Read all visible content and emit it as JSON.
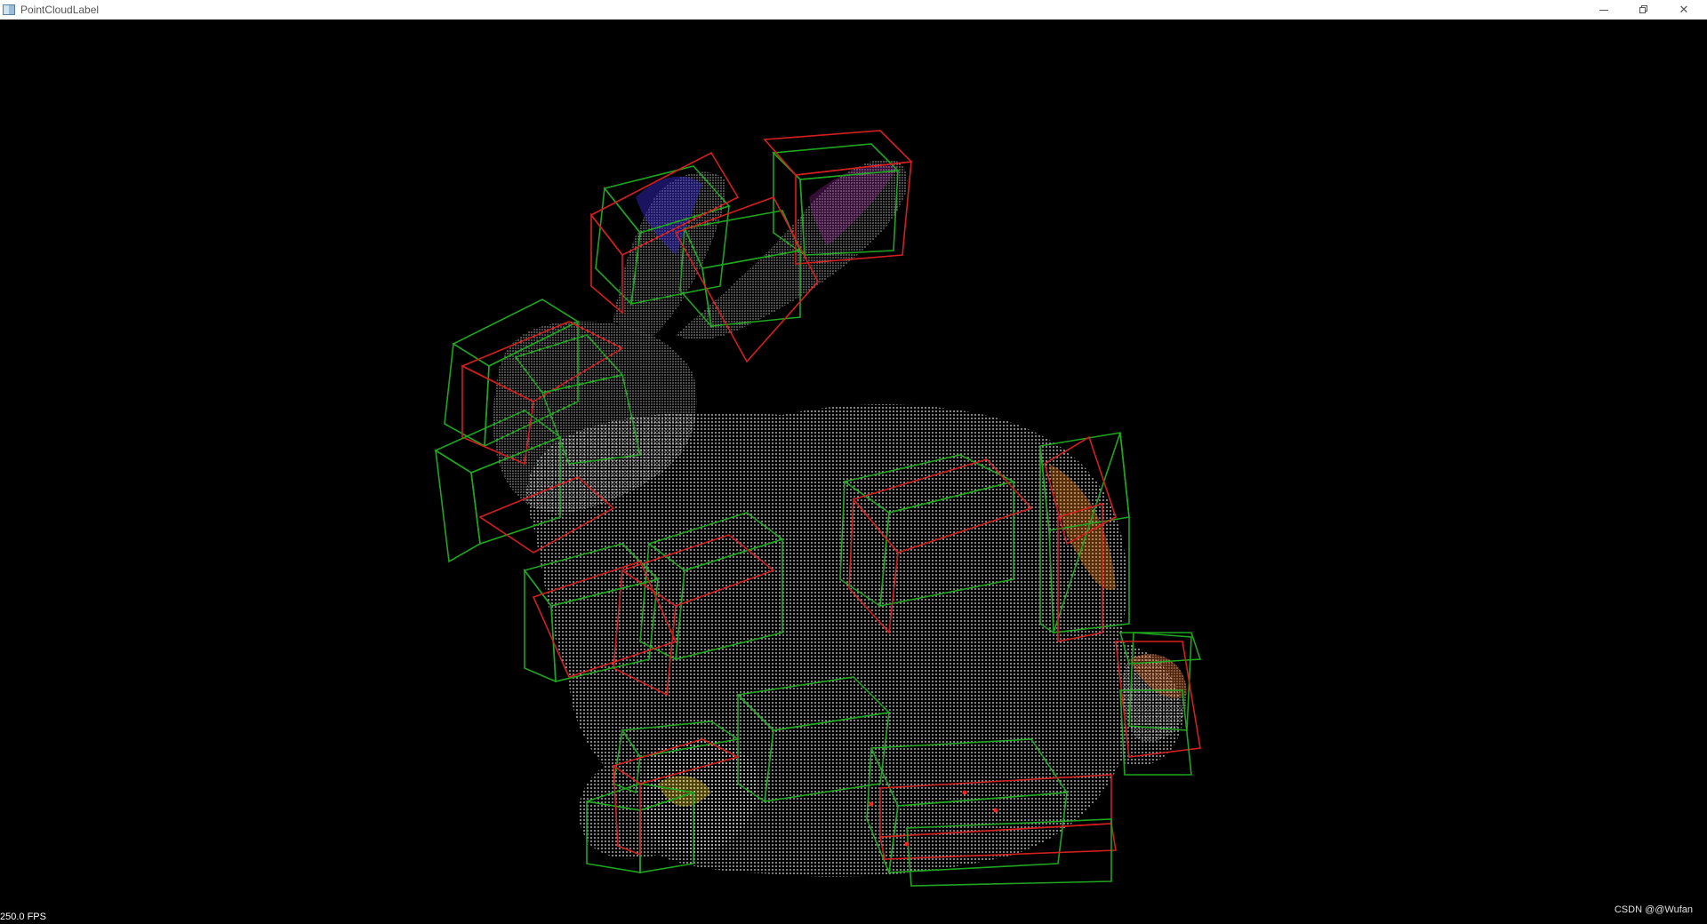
{
  "window": {
    "title": "PointCloudLabel",
    "controls": {
      "minimize": "minimize",
      "restore": "restore",
      "close": "close"
    }
  },
  "viewport": {
    "background": "#000000",
    "point_color": "#ffffff",
    "box_colors": [
      "#1fa51f",
      "#d41f1f"
    ],
    "fps": "250.0 FPS",
    "watermark": "CSDN @@Wufan"
  }
}
